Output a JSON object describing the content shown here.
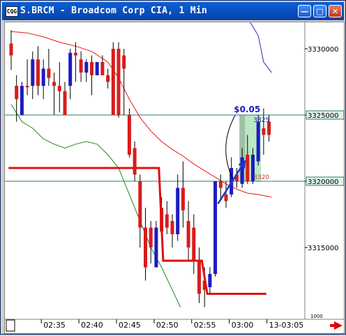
{
  "window": {
    "title": "S.BRCM - Broadcom Corp CIA, 1 Min",
    "minimize_icon": "minimize-icon",
    "maximize_icon": "maximize-icon",
    "close_icon": "close-icon",
    "app_icon_label": "CQG"
  },
  "chart_data": {
    "type": "candlestick",
    "title": "S.BRCM - Broadcom Corp CIA, 1 Min",
    "price_axis": {
      "ticks": [
        33300,
        33250,
        33200,
        33150
      ],
      "tick_labels": [
        "3330000",
        "3325000",
        "3320000",
        "3315000"
      ],
      "ylim": [
        33105,
        33332
      ],
      "bottom_label": "1000",
      "highlighted_labels": [
        "3325000",
        "3320000"
      ]
    },
    "time_axis": {
      "tick_labels": [
        "02:35",
        "02:40",
        "02:45",
        "02:50",
        "02:55",
        "03:00",
        "13-03:05"
      ],
      "tick_index": [
        6,
        13,
        20,
        27,
        34,
        41,
        48
      ]
    },
    "horizontal_lines": [
      33250,
      33200
    ],
    "candles": [
      {
        "o": 33304,
        "h": 33314,
        "l": 33284,
        "c": 33295,
        "color": "red"
      },
      {
        "o": 33262,
        "h": 33280,
        "l": 33245,
        "c": 33272,
        "color": "red"
      },
      {
        "o": 33250,
        "h": 33275,
        "l": 33250,
        "c": 33272,
        "color": "blue"
      },
      {
        "o": 33272,
        "h": 33292,
        "l": 33265,
        "c": 33272,
        "color": "red"
      },
      {
        "o": 33272,
        "h": 33298,
        "l": 33262,
        "c": 33292,
        "color": "blue"
      },
      {
        "o": 33292,
        "h": 33302,
        "l": 33265,
        "c": 33272,
        "color": "red"
      },
      {
        "o": 33272,
        "h": 33292,
        "l": 33262,
        "c": 33285,
        "color": "blue"
      },
      {
        "o": 33285,
        "h": 33300,
        "l": 33272,
        "c": 33278,
        "color": "red"
      },
      {
        "o": 33275,
        "h": 33282,
        "l": 33250,
        "c": 33272,
        "color": "red"
      },
      {
        "o": 33272,
        "h": 33290,
        "l": 33252,
        "c": 33268,
        "color": "red"
      },
      {
        "o": 33268,
        "h": 33275,
        "l": 33250,
        "c": 33250,
        "color": "red"
      },
      {
        "o": 33272,
        "h": 33300,
        "l": 33262,
        "c": 33297,
        "color": "blue"
      },
      {
        "o": 33297,
        "h": 33305,
        "l": 33275,
        "c": 33295,
        "color": "red"
      },
      {
        "o": 33292,
        "h": 33298,
        "l": 33275,
        "c": 33282,
        "color": "red"
      },
      {
        "o": 33282,
        "h": 33292,
        "l": 33275,
        "c": 33290,
        "color": "blue"
      },
      {
        "o": 33290,
        "h": 33295,
        "l": 33265,
        "c": 33280,
        "color": "red"
      },
      {
        "o": 33280,
        "h": 33290,
        "l": 33280,
        "c": 33290,
        "color": "blue"
      },
      {
        "o": 33290,
        "h": 33295,
        "l": 33282,
        "c": 33280,
        "color": "red"
      },
      {
        "o": 33280,
        "h": 33285,
        "l": 33270,
        "c": 33275,
        "color": "red"
      },
      {
        "o": 33300,
        "h": 33305,
        "l": 33250,
        "c": 33250,
        "color": "red"
      },
      {
        "o": 33300,
        "h": 33305,
        "l": 33248,
        "c": 33250,
        "color": "red"
      },
      {
        "o": 33295,
        "h": 33300,
        "l": 33250,
        "c": 33285,
        "color": "red"
      },
      {
        "o": 33250,
        "h": 33255,
        "l": 33218,
        "c": 33220,
        "color": "red"
      },
      {
        "o": 33225,
        "h": 33230,
        "l": 33200,
        "c": 33205,
        "color": "red"
      },
      {
        "o": 33200,
        "h": 33205,
        "l": 33150,
        "c": 33165,
        "color": "red"
      },
      {
        "o": 33165,
        "h": 33180,
        "l": 33125,
        "c": 33135,
        "color": "red"
      },
      {
        "o": 33165,
        "h": 33170,
        "l": 33138,
        "c": 33150,
        "color": "red"
      },
      {
        "o": 33135,
        "h": 33170,
        "l": 33135,
        "c": 33165,
        "color": "blue"
      },
      {
        "o": 33180,
        "h": 33188,
        "l": 33155,
        "c": 33162,
        "color": "red"
      },
      {
        "o": 33175,
        "h": 33185,
        "l": 33160,
        "c": 33165,
        "color": "red"
      },
      {
        "o": 33170,
        "h": 33175,
        "l": 33150,
        "c": 33160,
        "color": "red"
      },
      {
        "o": 33160,
        "h": 33205,
        "l": 33155,
        "c": 33195,
        "color": "blue"
      },
      {
        "o": 33195,
        "h": 33215,
        "l": 33165,
        "c": 33178,
        "color": "red"
      },
      {
        "o": 33170,
        "h": 33185,
        "l": 33140,
        "c": 33150,
        "color": "red"
      },
      {
        "o": 33165,
        "h": 33175,
        "l": 33130,
        "c": 33140,
        "color": "red"
      },
      {
        "o": 33140,
        "h": 33150,
        "l": 33108,
        "c": 33115,
        "color": "red"
      },
      {
        "o": 33118,
        "h": 33135,
        "l": 33105,
        "c": 33125,
        "color": "red"
      },
      {
        "o": 33120,
        "h": 33135,
        "l": 33115,
        "c": 33130,
        "color": "blue"
      },
      {
        "o": 33130,
        "h": 33200,
        "l": 33128,
        "c": 33200,
        "color": "blue"
      },
      {
        "o": 33200,
        "h": 33205,
        "l": 33185,
        "c": 33195,
        "color": "red"
      },
      {
        "o": 33190,
        "h": 33200,
        "l": 33180,
        "c": 33185,
        "color": "red"
      },
      {
        "o": 33190,
        "h": 33218,
        "l": 33188,
        "c": 33210,
        "color": "blue"
      },
      {
        "o": 33205,
        "h": 33210,
        "l": 33195,
        "c": 33200,
        "color": "red"
      },
      {
        "o": 33198,
        "h": 33225,
        "l": 33195,
        "c": 33218,
        "color": "blue"
      },
      {
        "o": 33220,
        "h": 33235,
        "l": 33198,
        "c": 33200,
        "color": "red"
      },
      {
        "o": 33200,
        "h": 33225,
        "l": 33198,
        "c": 33220,
        "color": "blue"
      },
      {
        "o": 33215,
        "h": 33250,
        "l": 33212,
        "c": 33245,
        "color": "blue"
      },
      {
        "o": 33240,
        "h": 33255,
        "l": 33220,
        "c": 33235,
        "color": "red"
      },
      {
        "o": 33245,
        "h": 33250,
        "l": 33230,
        "c": 33235,
        "color": "red"
      }
    ],
    "annotations": {
      "measure_label": "$0.05",
      "box_high_label": "3325",
      "box_low_label": "3320",
      "box_low": 33200,
      "box_high": 33250,
      "box_start": 42.5,
      "box_end": 46.5
    },
    "upper_band_blue": [
      {
        "i": 44.5,
        "v": 33335
      },
      {
        "i": 46,
        "v": 33310
      },
      {
        "i": 47,
        "v": 33290
      },
      {
        "i": 48.5,
        "v": 33282
      }
    ],
    "upper_band_red": [
      {
        "i": 0,
        "v": 33313
      },
      {
        "i": 3,
        "v": 33312
      },
      {
        "i": 6,
        "v": 33309
      },
      {
        "i": 9,
        "v": 33305
      },
      {
        "i": 12,
        "v": 33302
      },
      {
        "i": 15,
        "v": 33298
      },
      {
        "i": 18,
        "v": 33290
      },
      {
        "i": 20,
        "v": 33278
      },
      {
        "i": 22,
        "v": 33262
      },
      {
        "i": 24,
        "v": 33248
      },
      {
        "i": 26,
        "v": 33238
      },
      {
        "i": 28,
        "v": 33230
      },
      {
        "i": 30,
        "v": 33224
      },
      {
        "i": 32,
        "v": 33219
      },
      {
        "i": 34,
        "v": 33213
      },
      {
        "i": 36,
        "v": 33208
      },
      {
        "i": 38,
        "v": 33203
      },
      {
        "i": 40,
        "v": 33198
      },
      {
        "i": 42,
        "v": 33194
      },
      {
        "i": 44,
        "v": 33191
      },
      {
        "i": 46,
        "v": 33190
      },
      {
        "i": 48.5,
        "v": 33188
      }
    ],
    "lower_band_green": [
      {
        "i": 0,
        "v": 33258
      },
      {
        "i": 2,
        "v": 33245
      },
      {
        "i": 4,
        "v": 33240
      },
      {
        "i": 6,
        "v": 33232
      },
      {
        "i": 8,
        "v": 33228
      },
      {
        "i": 10,
        "v": 33225
      },
      {
        "i": 12,
        "v": 33228
      },
      {
        "i": 14,
        "v": 33230
      },
      {
        "i": 16,
        "v": 33228
      },
      {
        "i": 18,
        "v": 33220
      },
      {
        "i": 20,
        "v": 33210
      },
      {
        "i": 22,
        "v": 33190
      },
      {
        "i": 24,
        "v": 33170
      },
      {
        "i": 26,
        "v": 33150
      },
      {
        "i": 28,
        "v": 33135
      },
      {
        "i": 30,
        "v": 33118
      },
      {
        "i": 31.5,
        "v": 33105
      }
    ],
    "step_line_red": [
      {
        "i": -0.5,
        "v": 33210
      },
      {
        "i": 27.5,
        "v": 33210
      },
      {
        "i": 28.3,
        "v": 33140
      },
      {
        "i": 35.5,
        "v": 33140
      },
      {
        "i": 36.5,
        "v": 33115
      },
      {
        "i": 47.5,
        "v": 33115
      }
    ],
    "arrow": {
      "from": {
        "i": 38.5,
        "v": 33183
      },
      "to": {
        "i": 43.5,
        "v": 33215
      }
    }
  }
}
